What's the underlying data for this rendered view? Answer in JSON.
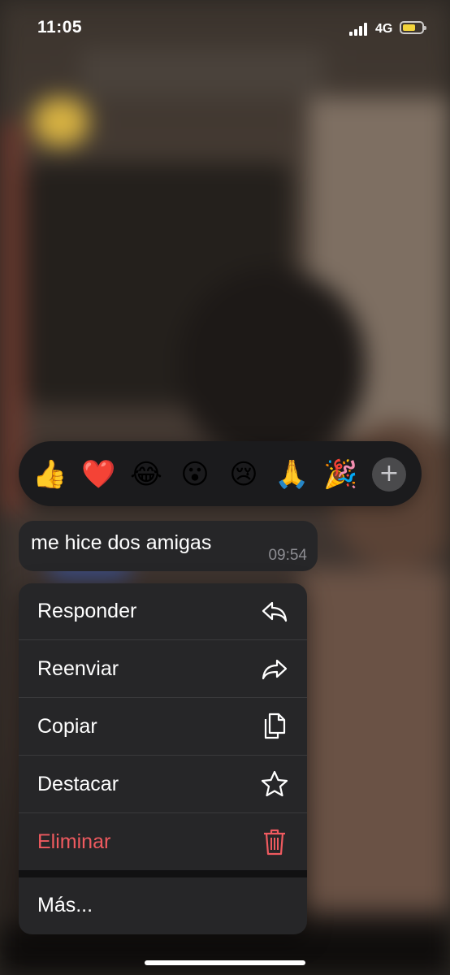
{
  "status_bar": {
    "time": "11:05",
    "network": "4G",
    "battery_color": "#f2d43b",
    "battery_level": 0.7
  },
  "reactions": [
    {
      "emoji": "👍",
      "name": "thumbs-up-reaction"
    },
    {
      "emoji": "❤️",
      "name": "heart-reaction"
    },
    {
      "emoji": "😂",
      "name": "laughing-reaction"
    },
    {
      "emoji": "😮",
      "name": "surprised-reaction"
    },
    {
      "emoji": "😢",
      "name": "crying-reaction"
    },
    {
      "emoji": "🙏",
      "name": "pray-reaction"
    },
    {
      "emoji": "🎉",
      "name": "party-reaction"
    }
  ],
  "reaction_more": "+",
  "message": {
    "text": "me hice dos amigas",
    "time": "09:54"
  },
  "menu": {
    "items": [
      {
        "label": "Responder",
        "icon": "reply-icon"
      },
      {
        "label": "Reenviar",
        "icon": "forward-icon"
      },
      {
        "label": "Copiar",
        "icon": "copy-icon"
      },
      {
        "label": "Destacar",
        "icon": "star-icon"
      },
      {
        "label": "Eliminar",
        "icon": "trash-icon"
      }
    ],
    "more_label": "Más...",
    "danger_color": "#ef5a5f"
  }
}
